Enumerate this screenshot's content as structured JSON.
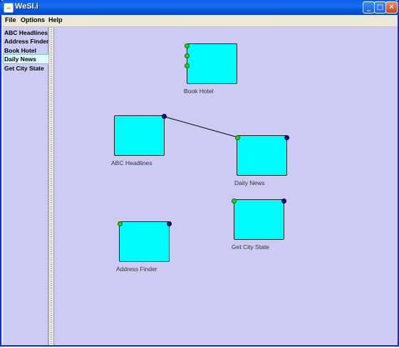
{
  "window": {
    "title": "WeSI.i",
    "app_icon": "java-cup-icon"
  },
  "window_controls": {
    "minimize_icon": "minimize-icon",
    "maximize_icon": "maximize-icon",
    "close_icon": "close-icon"
  },
  "menu": {
    "items": [
      "File",
      "Options",
      "Help"
    ]
  },
  "sidebar": {
    "items": [
      "ABC Headlines",
      "Address Finder",
      "Book Hotel",
      "Daily News",
      "Get City State"
    ],
    "selected": "Daily News"
  },
  "canvas": {
    "nodes": [
      {
        "label": "Book Hotel"
      },
      {
        "label": "ABC Headlines"
      },
      {
        "label": "Daily News"
      },
      {
        "label": "Address Finder"
      },
      {
        "label": "Get City State"
      }
    ],
    "connections": [
      {
        "from": "ABC Headlines",
        "to": "Daily News"
      }
    ]
  },
  "colors": {
    "canvas_background": "#cbcbf4",
    "node_fill": "#00fcfc",
    "input_port": "#2dcc2d",
    "output_port": "#10108a",
    "selection": "#dffaff"
  }
}
